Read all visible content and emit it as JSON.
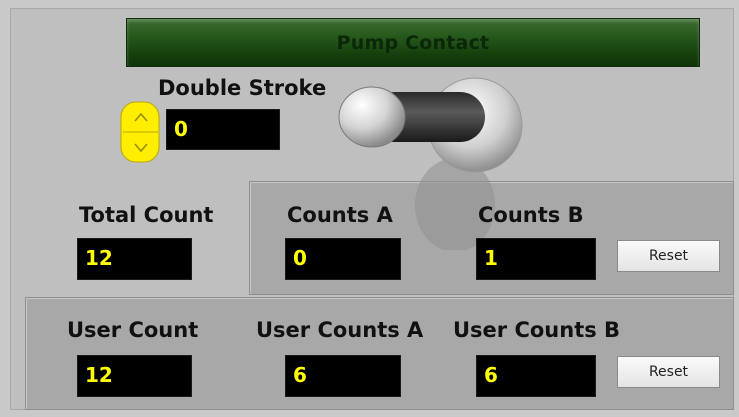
{
  "pump_contact": {
    "label": "Pump Contact",
    "lit": false
  },
  "double_stroke": {
    "label": "Double Stroke",
    "value": "0"
  },
  "total_count": {
    "label": "Total Count",
    "value": "12"
  },
  "counts_a": {
    "label": "Counts A",
    "value": "0"
  },
  "counts_b": {
    "label": "Counts B",
    "value": "1"
  },
  "reset_counts": {
    "label": "Reset"
  },
  "user_count": {
    "label": "User Count",
    "value": "12"
  },
  "user_counts_a": {
    "label": "User Counts A",
    "value": "6"
  },
  "user_counts_b": {
    "label": "User Counts B",
    "value": "6"
  },
  "reset_user_counts": {
    "label": "Reset"
  },
  "toggle_switch": {
    "icon": "toggle-switch-icon",
    "state": "off"
  },
  "colors": {
    "led_green": "#285a1c",
    "indicator_bg": "#000000",
    "indicator_text": "#ffff00",
    "stepper_yellow": "#ffee00",
    "panel_bg": "#bfbfbf"
  }
}
